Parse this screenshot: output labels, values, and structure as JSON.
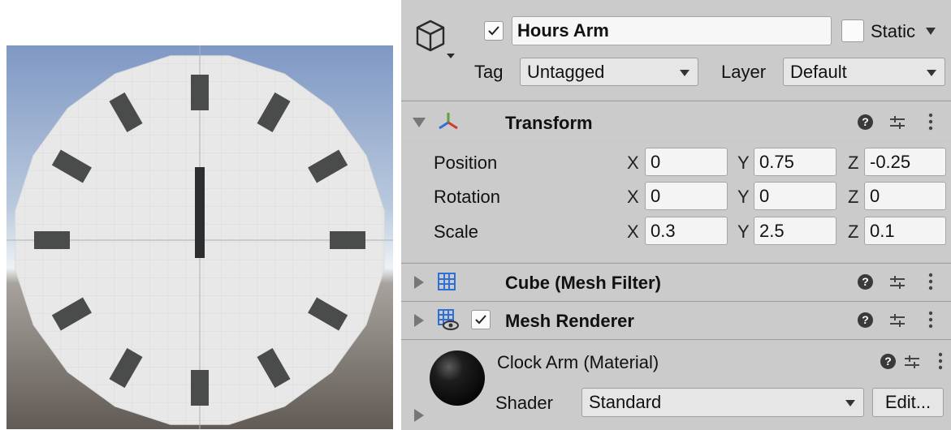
{
  "scene": {
    "sky_top": "#8aa2c8",
    "sky_horizon": "#e8eef5",
    "ground": "#6e6660",
    "clock_face": "#e9e9e9",
    "marker_color": "#4a4c4c"
  },
  "object": {
    "name": "Hours Arm",
    "active_checked": true,
    "static_label": "Static",
    "static_checked": false,
    "tag_label": "Tag",
    "tag_value": "Untagged",
    "layer_label": "Layer",
    "layer_value": "Default"
  },
  "transform": {
    "title": "Transform",
    "rows": [
      {
        "label": "Position",
        "x": "0",
        "y": "0.75",
        "z": "-0.25"
      },
      {
        "label": "Rotation",
        "x": "0",
        "y": "0",
        "z": "0"
      },
      {
        "label": "Scale",
        "x": "0.3",
        "y": "2.5",
        "z": "0.1"
      }
    ],
    "axis_x": "X",
    "axis_y": "Y",
    "axis_z": "Z"
  },
  "components": {
    "mesh_filter": "Cube (Mesh Filter)",
    "mesh_renderer": "Mesh Renderer",
    "mesh_renderer_checked": true
  },
  "material": {
    "name": "Clock Arm (Material)",
    "shader_label": "Shader",
    "shader_value": "Standard",
    "edit_label": "Edit..."
  },
  "icons": {
    "help": "?",
    "preset": "sliders-icon",
    "menu": "kebab-menu-icon"
  }
}
